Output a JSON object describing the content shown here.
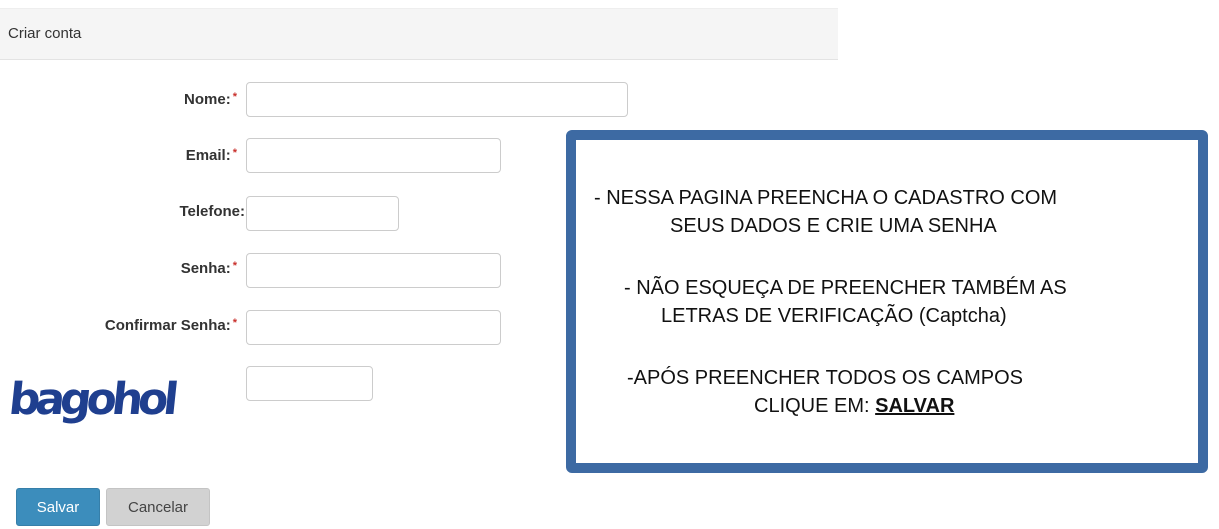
{
  "panel": {
    "title": "Criar conta"
  },
  "form": {
    "fields": [
      {
        "label": "Nome:",
        "required": true,
        "value": ""
      },
      {
        "label": "Email:",
        "required": true,
        "value": ""
      },
      {
        "label": "Telefone:",
        "required": false,
        "value": ""
      },
      {
        "label": "Senha:",
        "required": true,
        "value": ""
      },
      {
        "label": "Confirmar Senha:",
        "required": true,
        "value": ""
      }
    ],
    "required_marker": "*",
    "captcha": {
      "text": "bagohol",
      "input_value": ""
    }
  },
  "buttons": {
    "save_label": "Salvar",
    "cancel_label": "Cancelar"
  },
  "note": {
    "line1": "- NESSA PAGINA PREENCHA O CADASTRO COM",
    "line2": "SEUS DADOS E CRIE UMA SENHA",
    "line3": "- NÃO ESQUEÇA DE PREENCHER TAMBÉM AS",
    "line4": "LETRAS DE VERIFICAÇÃO (Captcha)",
    "line5": "-APÓS PREENCHER TODOS OS CAMPOS",
    "line6_prefix": "CLIQUE EM:",
    "line6_emphasis": "SALVAR"
  },
  "colors": {
    "primary_button": "#3c8dbc",
    "note_border": "#3d6aa3",
    "captcha_text": "#1f3f8f",
    "required_marker": "#c9302c"
  }
}
